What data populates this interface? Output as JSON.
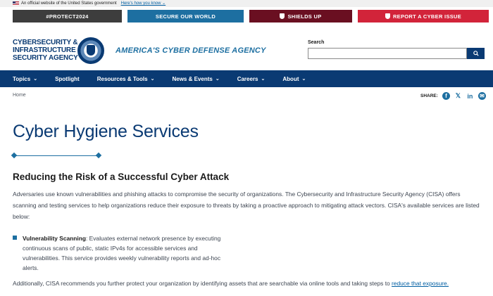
{
  "gov_banner": {
    "text": "An official website of the United States government",
    "how_link": "Here's how you know ⌄"
  },
  "top_buttons": {
    "protect": "#PROTECT2024",
    "secure": "SECURE OUR WORLD",
    "shields": "SHIELDS UP",
    "report": "REPORT A CYBER ISSUE"
  },
  "header": {
    "logo_line1": "CYBERSECURITY &",
    "logo_line2": "INFRASTRUCTURE",
    "logo_line3": "SECURITY AGENCY",
    "tagline": "AMERICA'S CYBER DEFENSE AGENCY",
    "search_label": "Search",
    "search_placeholder": ""
  },
  "nav": {
    "items": [
      {
        "label": "Topics"
      },
      {
        "label": "Spotlight"
      },
      {
        "label": "Resources & Tools"
      },
      {
        "label": "News & Events"
      },
      {
        "label": "Careers"
      },
      {
        "label": "About"
      }
    ]
  },
  "breadcrumb": {
    "home": "Home"
  },
  "share": {
    "label": "SHARE:"
  },
  "main": {
    "title": "Cyber Hygiene Services",
    "section_heading": "Reducing the Risk of a Successful Cyber Attack",
    "intro": "Adversaries use known vulnerabilities and phishing attacks to compromise the security of organizations. The Cybersecurity and Infrastructure Security Agency (CISA) offers scanning and testing services to help organizations reduce their exposure to threats by taking a proactive approach to mitigating attack vectors. CISA's available services are listed below:",
    "bullet_title": "Vulnerability Scanning",
    "bullet_text": ": Evaluates external network presence by executing continuous scans of public, static IPv4s for accessible services and vulnerabilities. This service provides weekly vulnerability reports and ad-hoc alerts.",
    "additional_text": "Additionally, CISA recommends you further protect your organization by identifying assets that are searchable via online tools and taking steps to ",
    "additional_link": "reduce that exposure."
  },
  "colors": {
    "navy": "#0a3a73",
    "accent_blue": "#1d6fa1",
    "maroon": "#6a0f21",
    "red": "#d2243a"
  }
}
